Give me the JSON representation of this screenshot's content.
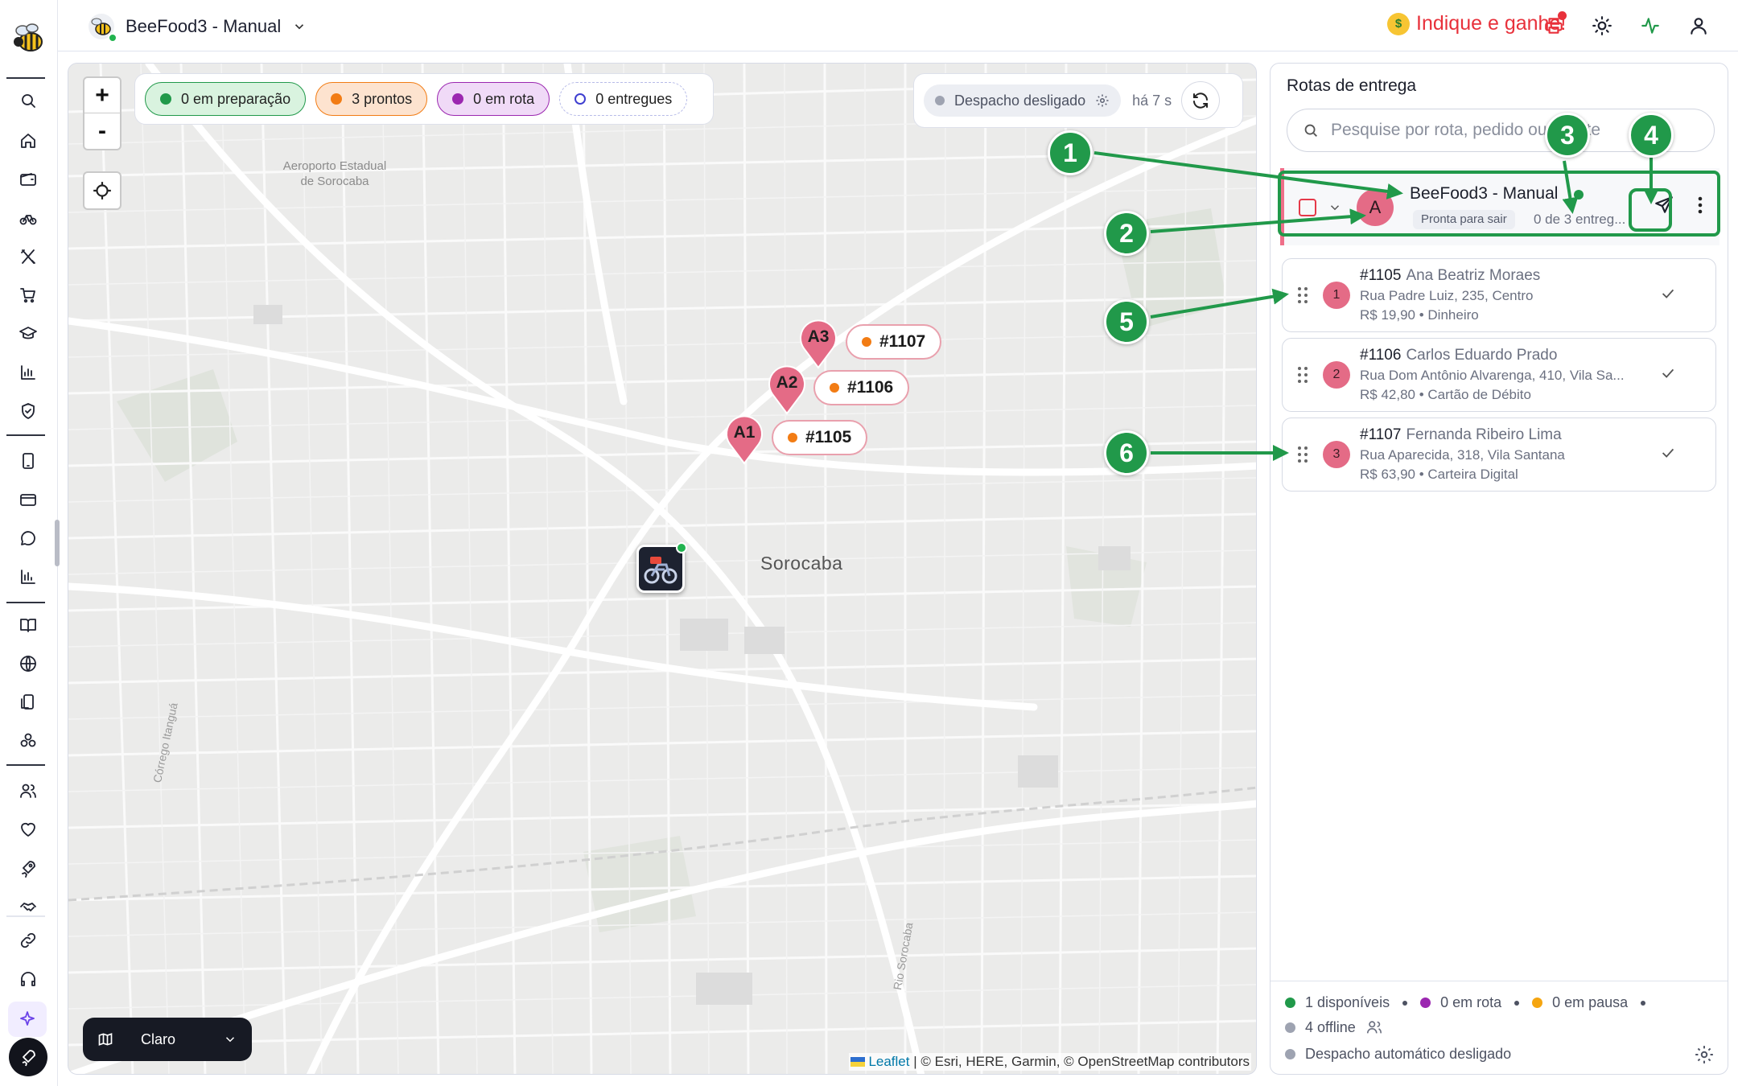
{
  "topbar": {
    "store_name": "BeeFood3 - Manual",
    "referral_label": "Indique e ganhe!"
  },
  "map": {
    "zoom_in": "+",
    "zoom_out": "-",
    "status_pills": [
      {
        "label": "0 em preparação",
        "color": "#21994a"
      },
      {
        "label": "3 prontos",
        "color": "#f27c14"
      },
      {
        "label": "0 em rota",
        "color": "#9b27b0"
      },
      {
        "label": "0 entregues",
        "color": "#3f3fd0"
      }
    ],
    "dispatch_status": "Despacho desligado",
    "dispatch_ago": "há 7 s",
    "pins": [
      {
        "label": "A3",
        "order": "#1107"
      },
      {
        "label": "A2",
        "order": "#1106"
      },
      {
        "label": "A1",
        "order": "#1105"
      }
    ],
    "city_label": "Sorocaba",
    "airport_label": "Aeroporto Estadual de Sorocaba",
    "creek_label": "Córrego Itanguá",
    "river_label": "Rio Sorocaba",
    "map_style": "Claro",
    "attribution_link": "Leaflet",
    "attribution_text": "| © Esri, HERE, Garmin, © OpenStreetMap contributors"
  },
  "panel": {
    "title": "Rotas de entrega",
    "search_placeholder": "Pesquise por rota, pedido ou cliente",
    "route": {
      "avatar": "A",
      "name": "BeeFood3 - Manual",
      "status": "Pronta para sair",
      "progress": "0 de 3 entreg..."
    },
    "orders": [
      {
        "seq": "1",
        "id": "#1105",
        "customer": "Ana Beatriz Moraes",
        "address": "Rua Padre Luiz, 235, Centro",
        "total": "R$ 19,90",
        "payment": "Dinheiro"
      },
      {
        "seq": "2",
        "id": "#1106",
        "customer": "Carlos Eduardo Prado",
        "address": "Rua Dom Antônio Alvarenga, 410, Vila Sa...",
        "total": "R$ 42,80",
        "payment": "Cartão de Débito"
      },
      {
        "seq": "3",
        "id": "#1107",
        "customer": "Fernanda Ribeiro Lima",
        "address": "Rua Aparecida, 318, Vila Santana",
        "total": "R$ 63,90",
        "payment": "Carteira Digital"
      }
    ],
    "footer": {
      "available": "1 disponíveis",
      "on_route": "0 em rota",
      "paused": "0 em pausa",
      "offline": "4 offline",
      "auto_dispatch": "Despacho automático desligado"
    }
  },
  "annotations": [
    "1",
    "2",
    "3",
    "4",
    "5",
    "6"
  ],
  "colors": {
    "accent_green": "#21994a",
    "pin_pink": "#e46b86",
    "alert_red": "#e8313b",
    "order_orange": "#f27c14"
  }
}
